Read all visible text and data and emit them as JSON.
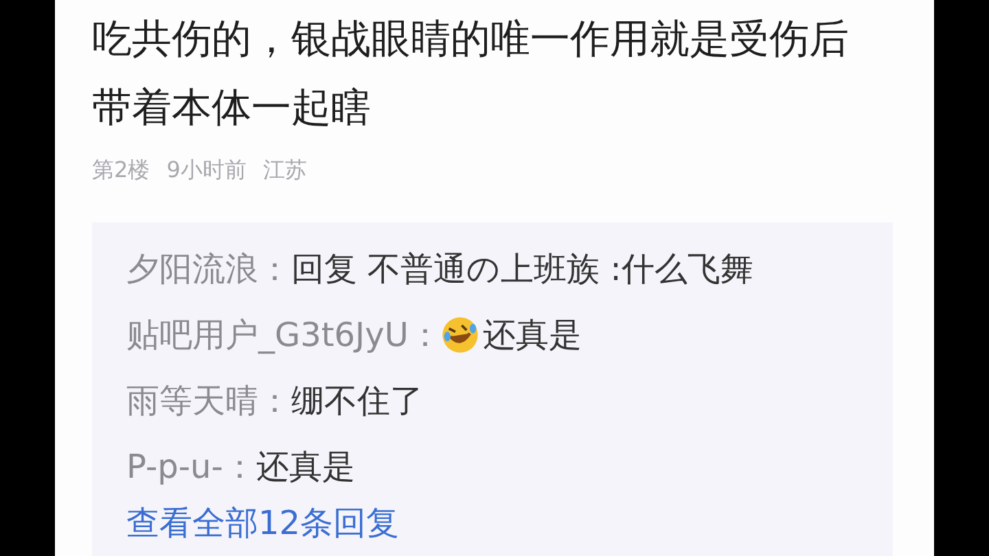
{
  "post": {
    "body": "吃共伤的，银战眼睛的唯一作用就是受伤后带着本体一起瞎",
    "meta": [
      "第2楼",
      "9小时前",
      "江苏"
    ]
  },
  "replies": [
    {
      "name": "夕阳流浪：",
      "text": "回复 不普通の上班族 :什么飞舞",
      "has_emoji": false
    },
    {
      "name": "贴吧用户_G3t6JyU：",
      "text": "还真是",
      "has_emoji": true
    },
    {
      "name": "雨等天晴：",
      "text": "绷不住了",
      "has_emoji": false
    },
    {
      "name": "P-p-u-：",
      "text": "还真是",
      "has_emoji": false
    }
  ],
  "more_link": "查看全部12条回复"
}
